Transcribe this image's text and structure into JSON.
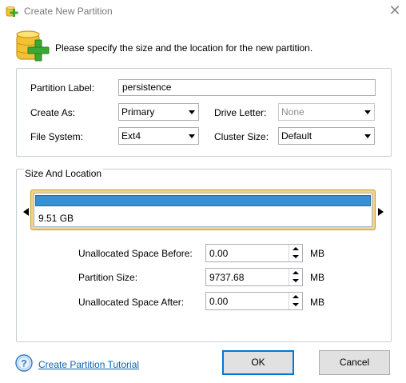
{
  "window": {
    "title": "Create New Partition",
    "close_glyph": "✕",
    "title_icon": "partition-add-icon"
  },
  "header": {
    "icon": "partition-add-large-icon",
    "text": "Please specify the size and the location for the new partition."
  },
  "partition_settings": {
    "label_field": {
      "label": "Partition Label:",
      "value": "persistence"
    },
    "create_as": {
      "label": "Create As:",
      "value": "Primary"
    },
    "drive_letter": {
      "label": "Drive Letter:",
      "value": "None"
    },
    "file_system": {
      "label": "File System:",
      "value": "Ext4"
    },
    "cluster_size": {
      "label": "Cluster Size:",
      "value": "Default"
    }
  },
  "size_location": {
    "title": "Size And Location",
    "disk_size_text": "9.51 GB",
    "bar_fill_fraction": 1.0,
    "accent": "#3a8fd0",
    "unallocated_before": {
      "label": "Unallocated Space Before:",
      "value": "0.00",
      "unit": "MB"
    },
    "partition_size": {
      "label": "Partition Size:",
      "value": "9737.68",
      "unit": "MB"
    },
    "unallocated_after": {
      "label": "Unallocated Space After:",
      "value": "0.00",
      "unit": "MB"
    }
  },
  "footer": {
    "help_icon": "help-question-icon",
    "tutorial_link": "Create Partition Tutorial",
    "ok_label": "OK",
    "cancel_label": "Cancel"
  }
}
